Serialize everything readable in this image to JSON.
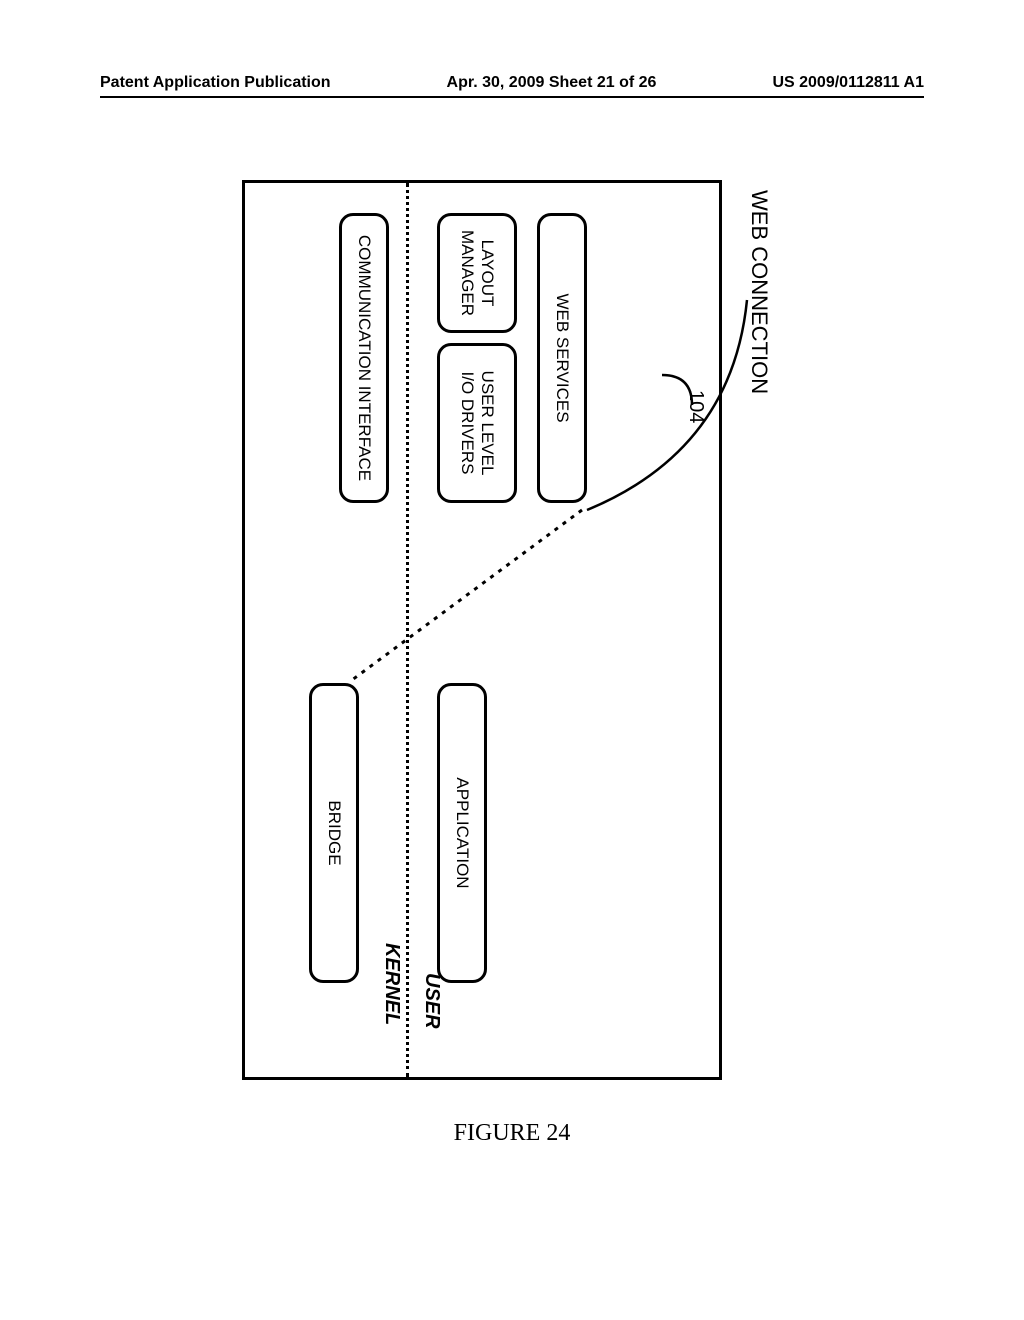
{
  "header": {
    "left": "Patent Application Publication",
    "center": "Apr. 30, 2009  Sheet 21 of 26",
    "right": "US 2009/0112811 A1"
  },
  "diagram": {
    "web_connection": "WEB CONNECTION",
    "ref": "104",
    "user_label": "USER",
    "kernel_label": "KERNEL",
    "boxes": {
      "web_services": "WEB SERVICES",
      "user_level": "USER LEVEL\nI/O DRIVERS",
      "layout_mgr": "LAYOUT\nMANAGER",
      "comm_interface": "COMMUNICATION INTERFACE",
      "application": "APPLICATION",
      "bridge": "BRIDGE"
    }
  },
  "figure_caption": "FIGURE 24"
}
